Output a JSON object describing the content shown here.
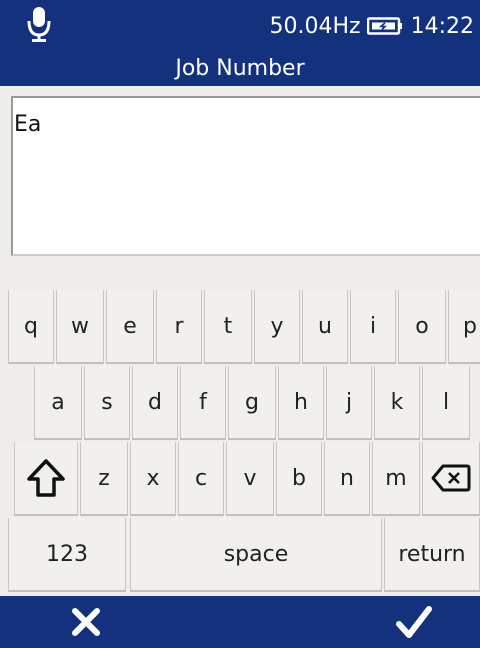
{
  "status_bar": {
    "frequency": "50.04Hz",
    "time": "14:22",
    "mic_icon": "microphone-icon",
    "battery_icon": "battery-charging-icon"
  },
  "header": {
    "title": "Job Number"
  },
  "text_input": {
    "value": "Ea"
  },
  "keyboard": {
    "row1": [
      "q",
      "w",
      "e",
      "r",
      "t",
      "y",
      "u",
      "i",
      "o",
      "p"
    ],
    "row2": [
      "a",
      "s",
      "d",
      "f",
      "g",
      "h",
      "j",
      "k",
      "l"
    ],
    "row3": [
      "z",
      "x",
      "c",
      "v",
      "b",
      "n",
      "m"
    ],
    "shift_icon": "shift-icon",
    "backspace_icon": "backspace-icon",
    "numbers_label": "123",
    "space_label": "space",
    "return_label": "return"
  },
  "footer": {
    "cancel_icon": "close-icon",
    "confirm_icon": "checkmark-icon"
  },
  "colors": {
    "header_bg": "#13317c",
    "keyboard_bg": "#efedea",
    "key_bg": "#f2f0ed"
  }
}
